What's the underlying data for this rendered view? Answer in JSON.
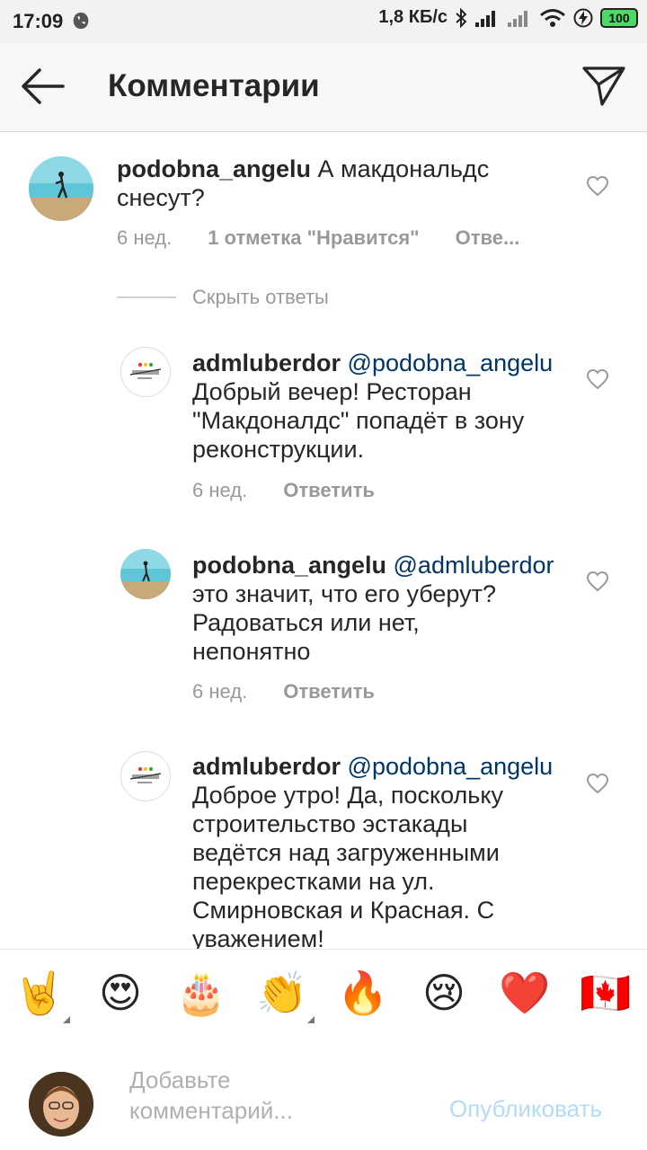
{
  "status_bar": {
    "time": "17:09",
    "speed": "1,8 КБ/с",
    "battery": "100"
  },
  "header": {
    "title": "Комментарии"
  },
  "comments": [
    {
      "username": "podobna_angelu",
      "text_line1": "А макдональдс",
      "text_line2": "снесут?",
      "time": "6 нед.",
      "likes": "1 отметка \"Нравится\"",
      "reply": "Отве..."
    }
  ],
  "hide_replies_label": "Скрыть ответы",
  "replies": [
    {
      "username": "admluberdor",
      "mention": "@podobna_angelu",
      "lines": [
        "Добрый вечер! Ресторан",
        "\"Макдоналдс\" попадёт в зону",
        "реконструкции."
      ],
      "time": "6 нед.",
      "reply": "Ответить"
    },
    {
      "username": "podobna_angelu",
      "mention": "@admluberdor",
      "lines": [
        "это значит,  что его уберут?",
        "Радоваться или нет,",
        "непонятно"
      ],
      "time": "6 нед.",
      "reply": "Ответить"
    },
    {
      "username": "admluberdor",
      "mention": "@podobna_angelu",
      "lines": [
        "Доброе утро! Да, поскольку",
        "строительство эстакады",
        "ведётся над загруженными",
        "перекрестками на ул.",
        "Смирновская и Красная. С",
        "уважением!"
      ]
    }
  ],
  "emoji_bar": [
    "🤘",
    "😍",
    "🎂",
    "👏",
    "🔥",
    "😢",
    "❤️",
    "🇨🇦"
  ],
  "composer": {
    "placeholder_line1": "Добавьте",
    "placeholder_line2": "комментарий...",
    "publish_label": "Опубликовать"
  },
  "colors": {
    "mention": "#003569",
    "publish_disabled": "#b3dbf5",
    "muted": "#999999"
  }
}
